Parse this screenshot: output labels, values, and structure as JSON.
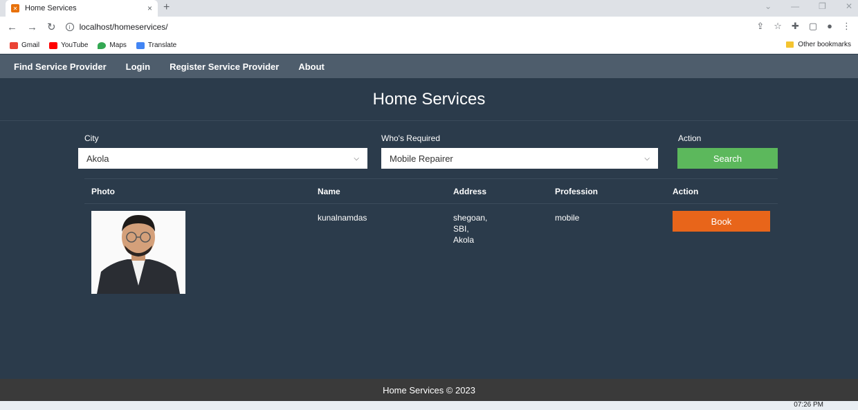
{
  "browser": {
    "tab_title": "Home Services",
    "tab_close": "×",
    "new_tab": "+",
    "url": "localhost/homeservices/",
    "bookmarks": [
      {
        "label": "Gmail",
        "color": "#ea4335"
      },
      {
        "label": "YouTube",
        "color": "#ff0000"
      },
      {
        "label": "Maps",
        "color": "#34a853"
      },
      {
        "label": "Translate",
        "color": "#4285f4"
      }
    ],
    "other_bookmarks": "Other bookmarks"
  },
  "nav": {
    "items": [
      "Find Service Provider",
      "Login",
      "Register Service Provider",
      "About"
    ]
  },
  "hero": {
    "title": "Home Services"
  },
  "form": {
    "city_label": "City",
    "city_value": "Akola",
    "required_label": "Who's Required",
    "required_value": "Mobile Repairer",
    "action_label": "Action",
    "search_label": "Search"
  },
  "table": {
    "headers": [
      "Photo",
      "Name",
      "Address",
      "Profession",
      "Action"
    ],
    "rows": [
      {
        "name": "kunalnamdas",
        "address": [
          "shegoan,",
          "SBI,",
          "Akola"
        ],
        "profession": "mobile",
        "action": "Book"
      }
    ]
  },
  "footer": {
    "text": "Home Services © 2023"
  },
  "taskbar": {
    "time": "07:26 PM"
  },
  "colors": {
    "search": "#5cb85c",
    "book": "#e8651a",
    "nav": "#4e5d6c",
    "body": "#2b3b4b"
  }
}
